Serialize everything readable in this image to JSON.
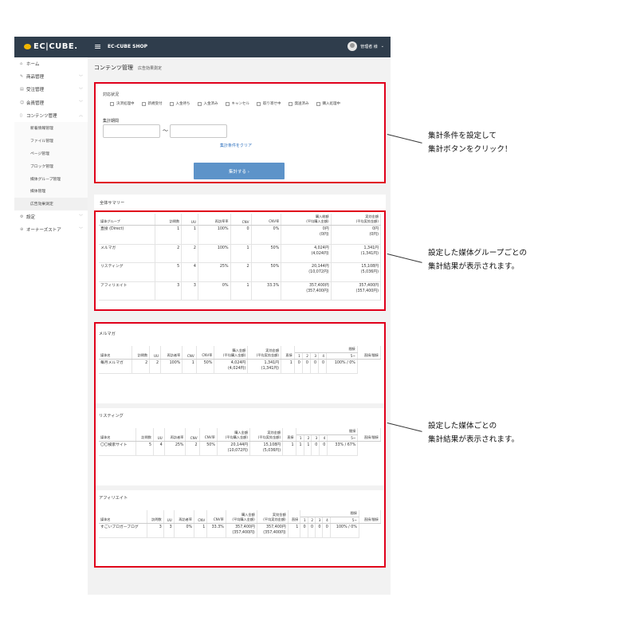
{
  "header": {
    "logo": "EC|CUBE.",
    "shop_name": "EC-CUBE SHOP",
    "user": "管理者 様"
  },
  "sidebar": {
    "items": [
      {
        "label": "ホーム",
        "icon": "home-icon",
        "chev": ""
      },
      {
        "label": "商品管理",
        "icon": "tag-icon",
        "chev": "﹀"
      },
      {
        "label": "受注管理",
        "icon": "cart-icon",
        "chev": "﹀"
      },
      {
        "label": "会員管理",
        "icon": "users-icon",
        "chev": "﹀"
      },
      {
        "label": "コンテンツ管理",
        "icon": "file-icon",
        "chev": "︿"
      }
    ],
    "sub_items": [
      "新着情報管理",
      "ファイル管理",
      "ページ管理",
      "ブロック管理",
      "媒体グループ管理",
      "媒体管理",
      "広告効果測定"
    ],
    "items2": [
      {
        "label": "設定",
        "icon": "gear-icon",
        "chev": "﹀"
      },
      {
        "label": "オーナーズストア",
        "icon": "store-icon",
        "chev": "﹀"
      }
    ]
  },
  "page": {
    "title": "コンテンツ管理",
    "subtitle": "広告効果測定"
  },
  "filter": {
    "status_label": "対応状況",
    "statuses": [
      "決済処理中",
      "新規受付",
      "入金待ち",
      "入金済み",
      "キャンセル",
      "取り寄せ中",
      "発送済み",
      "購入処理中"
    ],
    "period_label": "集計期間",
    "range_sep": "〜",
    "clear_label": "集計条件をクリア",
    "submit_label": "集計する ›"
  },
  "summary": {
    "title": "全体サマリー",
    "headers": [
      "媒体グループ",
      "訪問数",
      "UU",
      "再訪率率",
      "CNV",
      "CNV率",
      "購入総額\n(平均購入金額)",
      "実効金額\n(平均実効金額)"
    ],
    "rows": [
      [
        "直接 (Direct)",
        "1",
        "1",
        "100%",
        "0",
        "0%",
        "0円",
        "(0円)",
        "0円",
        "(0円)"
      ],
      [
        "メルマガ",
        "2",
        "2",
        "100%",
        "1",
        "50%",
        "4,024円",
        "(4,024円)",
        "1,341円",
        "(1,341円)"
      ],
      [
        "リスティング",
        "5",
        "4",
        "25%",
        "2",
        "50%",
        "20,144円",
        "(10,072円)",
        "15,108円",
        "(5,036円)"
      ],
      [
        "アフィリエイト",
        "3",
        "3",
        "0%",
        "1",
        "33.3%",
        "357,400円",
        "(357,400円)",
        "357,400円",
        "(357,400円)"
      ]
    ]
  },
  "media_groups": [
    {
      "title": "メルマガ",
      "headers": [
        "媒体名",
        "訪問数",
        "UU",
        "再訪者率",
        "CNV",
        "CNV率",
        "購入金額\n(平均購入金額)",
        "実効金額\n(平均実効金額)",
        "直接",
        "間接",
        "直接/間接"
      ],
      "sub_headers": [
        "1",
        "2",
        "3",
        "4",
        "5~"
      ],
      "row": [
        "毎月メルマガ",
        "2",
        "2",
        "100%",
        "1",
        "50%",
        "4,024円",
        "(4,024円)",
        "1,341円",
        "(1,341円)",
        "1",
        "0",
        "0",
        "0",
        "0",
        "100% / 0%"
      ]
    },
    {
      "title": "リスティング",
      "headers": [
        "媒体名",
        "訪問数",
        "UU",
        "再訪者率",
        "CNV",
        "CNV率",
        "購入金額\n(平均購入金額)",
        "実効金額\n(平均実効金額)",
        "直接",
        "間接",
        "直接/間接"
      ],
      "sub_headers": [
        "1",
        "2",
        "3",
        "4",
        "5~"
      ],
      "row": [
        "〇〇検索サイト",
        "5",
        "4",
        "25%",
        "2",
        "50%",
        "20,144円",
        "(10,072円)",
        "15,108円",
        "(5,036円)",
        "1",
        "1",
        "1",
        "0",
        "0",
        "33% / 67%"
      ]
    },
    {
      "title": "アフィリエイト",
      "headers": [
        "媒体名",
        "訪問数",
        "UU",
        "再訪者率",
        "CNV",
        "CNV率",
        "購入金額\n(平均購入金額)",
        "実効金額\n(平均実効金額)",
        "直接",
        "間接",
        "直接/間接"
      ],
      "sub_headers": [
        "1",
        "2",
        "3",
        "4",
        "5~"
      ],
      "row": [
        "すごいブロガーブログ",
        "3",
        "3",
        "0%",
        "1",
        "33.3%",
        "357,400円",
        "(357,400円)",
        "357,400円",
        "(357,400円)",
        "1",
        "0",
        "0",
        "0",
        "0",
        "100% / 0%"
      ]
    }
  ],
  "annotations": [
    {
      "l1": "集計条件を設定して",
      "l2": "集計ボタンをクリック！"
    },
    {
      "l1": "設定した媒体グループごとの",
      "l2": "集計結果が表示されます。"
    },
    {
      "l1": "設定した媒体ごとの",
      "l2": "集計結果が表示されます。"
    }
  ]
}
